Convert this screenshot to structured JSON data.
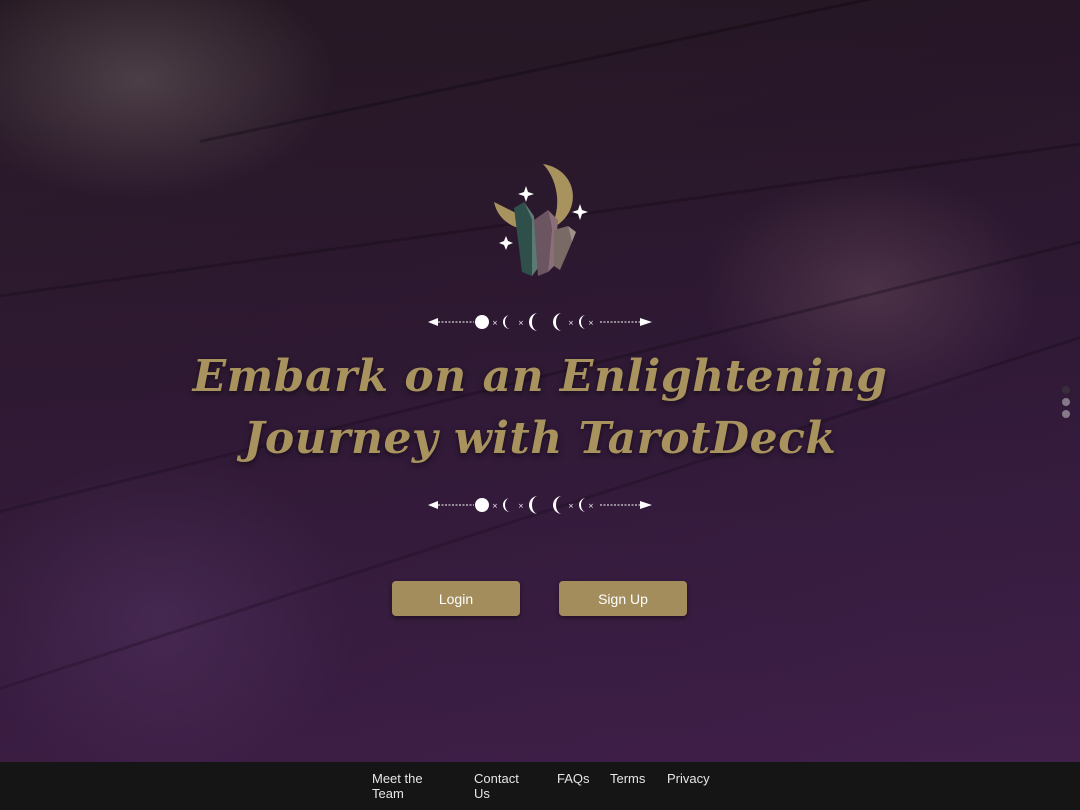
{
  "hero": {
    "headline_line1": "Embark on an Enlightening",
    "headline_line2": "Journey with TarotDeck",
    "logo_icon": "crescent-moon-crystals-icon",
    "divider_icon": "moon-phases-divider-icon"
  },
  "actions": {
    "login_label": "Login",
    "signup_label": "Sign Up"
  },
  "footer": {
    "links": [
      {
        "label": "Meet the Team"
      },
      {
        "label": "Contact Us"
      },
      {
        "label": "FAQs"
      },
      {
        "label": "Terms"
      },
      {
        "label": "Privacy"
      }
    ]
  },
  "colors": {
    "accent_gold": "#a38d5c",
    "headline_gold": "#a8925e",
    "footer_bg": "#151515"
  }
}
